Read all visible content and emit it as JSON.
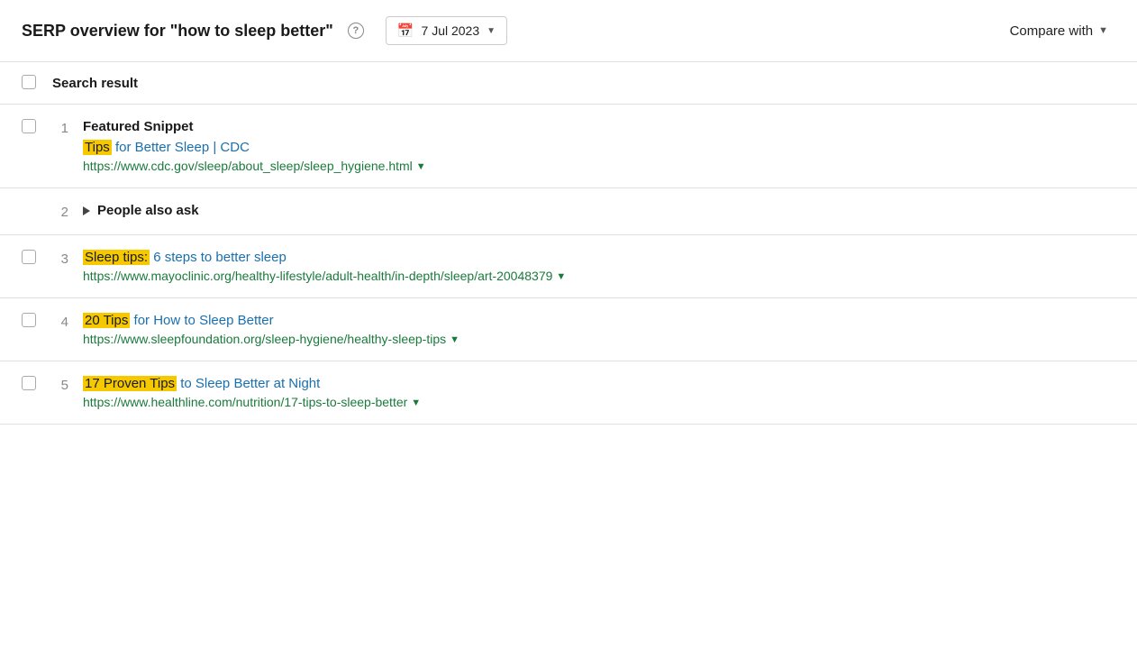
{
  "header": {
    "title": "SERP overview for \"how to sleep better\"",
    "help_label": "?",
    "date_label": "7 Jul 2023",
    "compare_label": "Compare with"
  },
  "table": {
    "col_label": "Search result"
  },
  "rows": [
    {
      "id": "row-1",
      "number": "1",
      "type": "Featured Snippet",
      "has_checkbox": true,
      "title_highlight": "Tips",
      "title_rest": " for Better Sleep | CDC",
      "url": "https://www.cdc.gov/sleep/about_sleep/sleep_hygiene.html",
      "url_has_chevron": true,
      "is_paa": false
    },
    {
      "id": "row-2",
      "number": "2",
      "type": null,
      "has_checkbox": false,
      "is_paa": true,
      "paa_label": "People also ask"
    },
    {
      "id": "row-3",
      "number": "3",
      "type": null,
      "has_checkbox": true,
      "title_highlight": "Sleep tips:",
      "title_rest": " 6 steps to better sleep",
      "url": "https://www.mayoclinic.org/healthy-lifestyle/adult-health/in-depth/sleep/art-20048379",
      "url_has_chevron": true,
      "is_paa": false
    },
    {
      "id": "row-4",
      "number": "4",
      "type": null,
      "has_checkbox": true,
      "title_highlight": "20 Tips",
      "title_rest": " for How to Sleep Better",
      "url": "https://www.sleepfoundation.org/sleep-hygiene/healthy-sleep-tips",
      "url_has_chevron": true,
      "is_paa": false
    },
    {
      "id": "row-5",
      "number": "5",
      "type": null,
      "has_checkbox": true,
      "title_highlight": "17 Proven Tips",
      "title_rest": " to Sleep Better at Night",
      "url": "https://www.healthline.com/nutrition/17-tips-to-sleep-better",
      "url_has_chevron": true,
      "is_paa": false
    }
  ]
}
